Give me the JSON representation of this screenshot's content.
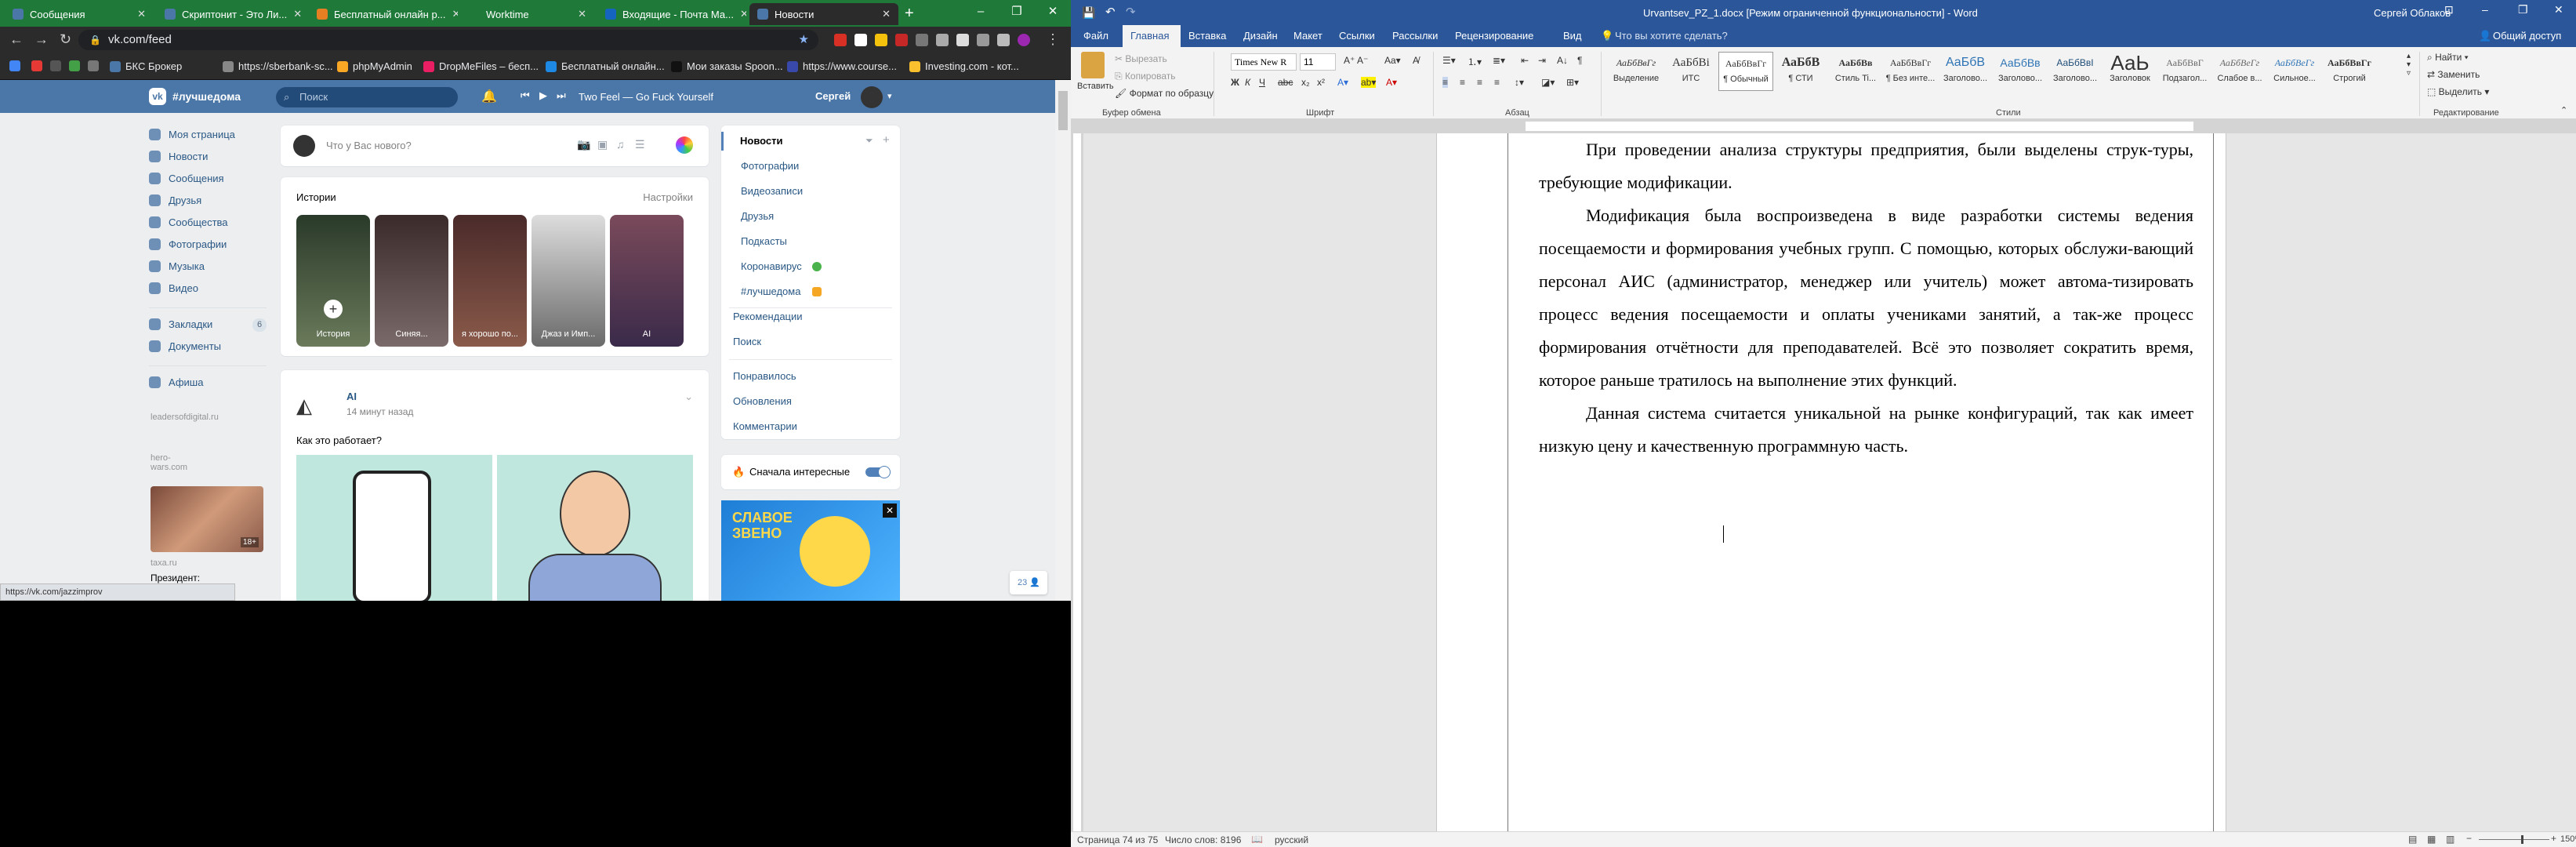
{
  "browser": {
    "tabs": [
      {
        "title": "Сообщения"
      },
      {
        "title": "Скриптонит - Это Ли..."
      },
      {
        "title": "Бесплатный онлайн р..."
      },
      {
        "title": "Worktime"
      },
      {
        "title": "Входящие - Почта Ма..."
      },
      {
        "title": "Новости"
      }
    ],
    "new_tab": "+",
    "url": "vk.com/feed",
    "bookmarks": [
      "БКС Брокер",
      "https://sberbank-sc...",
      "phpMyAdmin",
      "DropMeFiles – бесп...",
      "Бесплатный онлайн...",
      "Мои заказы Spoon...",
      "https://www.course...",
      "Investing.com - кот..."
    ],
    "status_url": "https://vk.com/jazzimprov"
  },
  "vk": {
    "logo": "#лучшедома",
    "search_placeholder": "Поиск",
    "player_track": "Two Feel — Go Fuck Yourself",
    "user_name": "Сергей",
    "left_menu": [
      "Моя страница",
      "Новости",
      "Сообщения",
      "Друзья",
      "Сообщества",
      "Фотографии",
      "Музыка",
      "Видео"
    ],
    "left_menu2": [
      "Закладки",
      "Документы"
    ],
    "bookmarks_count": "6",
    "left_menu3": [
      "Афиша"
    ],
    "left_links": [
      "leadersofdigital.ru",
      "hero-wars.com"
    ],
    "ad": {
      "age": "18+",
      "source": "taxa.ru",
      "text": "Президент: все граждане"
    },
    "composer_placeholder": "Что у Вас нового?",
    "stories": {
      "title": "Истории",
      "settings": "Настройки",
      "items": [
        "История",
        "Синяя...",
        "я хорошо по...",
        "Джаз и Имп...",
        "AI"
      ]
    },
    "post": {
      "author": "AI",
      "time": "14 минут назад",
      "text": "Как это работает?"
    },
    "right_menu": {
      "active": "Новости",
      "sub": [
        "Фотографии",
        "Видеозаписи",
        "Друзья",
        "Подкасты",
        "Коронавирус",
        "#лучшедома"
      ],
      "other": [
        "Рекомендации",
        "Поиск"
      ],
      "other2": [
        "Понравилось",
        "Обновления",
        "Комментарии"
      ]
    },
    "interesting_toggle": "Сначала интересные",
    "banner_text": "СЛАВОЕ ЗВЕНО",
    "chat_count": "23"
  },
  "word": {
    "title": "Urvantsev_PZ_1.docx [Режим ограниченной функциональности] - Word",
    "user": "Сергей Облаков",
    "share": "Общий доступ",
    "tabs": [
      "Файл",
      "Главная",
      "Вставка",
      "Дизайн",
      "Макет",
      "Ссылки",
      "Рассылки",
      "Рецензирование",
      "Вид"
    ],
    "tell_me": "Что вы хотите сделать?",
    "clipboard": {
      "paste": "Вставить",
      "cut": "Вырезать",
      "copy": "Копировать",
      "format": "Формат по образцу"
    },
    "font_name": "Times New R",
    "font_size": "11",
    "styles": [
      {
        "preview": "АаБбВвГг",
        "name": "Выделение"
      },
      {
        "preview": "АаБбВі",
        "name": "ИТС"
      },
      {
        "preview": "АаБбВвГг",
        "name": "¶ Обычный"
      },
      {
        "preview": "АаБбВ",
        "name": "¶ СТИ"
      },
      {
        "preview": "АаБбВв",
        "name": "Стиль Ti..."
      },
      {
        "preview": "АаБбВвГг",
        "name": "¶ Без инте..."
      },
      {
        "preview": "АаБбВ",
        "name": "Заголово..."
      },
      {
        "preview": "АаБбВв",
        "name": "Заголово..."
      },
      {
        "preview": "АаБбВвІ",
        "name": "Заголово..."
      },
      {
        "preview": "АаЬ",
        "name": "Заголовок"
      },
      {
        "preview": "АаБбВвГ",
        "name": "Подзагол..."
      },
      {
        "preview": "АаБбВеГг",
        "name": "Слабое в..."
      },
      {
        "preview": "АаБбВеГг",
        "name": "Сильное..."
      },
      {
        "preview": "АаБбВвГг",
        "name": "Строгий"
      }
    ],
    "editing": [
      "Найти",
      "Заменить",
      "Выделить"
    ],
    "groups": [
      "Буфер обмена",
      "Шрифт",
      "Абзац",
      "Стили",
      "Редактирование"
    ],
    "paragraphs": [
      "При проведении анализа структуры предприятия, были выделены струк-туры, требующие модификации.",
      "Модификация была воспроизведена в виде разработки системы ведения посещаемости и формирования учебных групп. С помощью, которых обслужи-вающий персонал АИС (администратор, менеджер или учитель) может автома-тизировать процесс ведения посещаемости и оплаты учениками занятий, а так-же процесс формирования отчётности для преподавателей. Всё это позволяет сократить время, которое раньше тратилось на выполнение этих функций.",
      "Данная система считается уникальной на рынке конфигураций, так как имеет низкую цену и качественную программную часть."
    ],
    "status": {
      "page": "Страница 74 из 75",
      "words": "Число слов: 8196",
      "lang": "русский",
      "zoom": "150%"
    }
  }
}
